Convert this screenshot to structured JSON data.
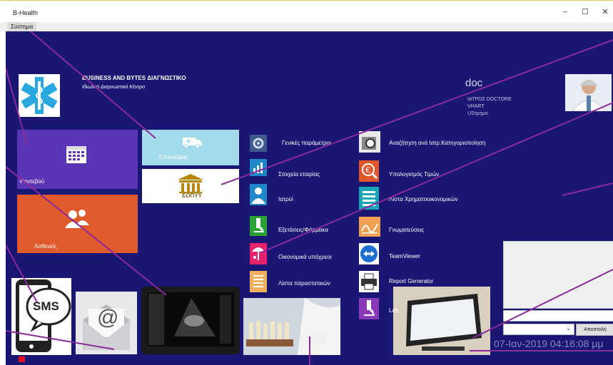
{
  "window": {
    "title": "B-Health",
    "min": "−",
    "max": "☐",
    "close": "✕"
  },
  "menu": {
    "system": "Σύστημα"
  },
  "clinic": {
    "name": "BUSINESS AND BYTES ΔΙΑΓΝΩΣΤΙΚΟ",
    "subtitle": "Ιδιωτικό Διαγνωστικό Κέντρο"
  },
  "user": {
    "short": "doc",
    "title": "ΙΑΤΡΟΣ DOCTORE",
    "name": "VHART",
    "dept": "USτμημα"
  },
  "tiles": {
    "appointments": "Ραντεβού",
    "visits": "Επισκέψεις",
    "patients": "Ασθενείς",
    "eopyy": "ΕΟΠΥΥ",
    "sms": "SMS",
    "email": "@"
  },
  "menu_col1": [
    {
      "label": "Γενικές παράμετροι",
      "icon": "gear-icon",
      "color": "#3e5a8a"
    },
    {
      "label": "Στοιχεία εταιρίας",
      "icon": "chart-icon",
      "color": "#1e88c8"
    },
    {
      "label": "Ιατροί",
      "icon": "doctor-icon",
      "color": "#1e88c8"
    },
    {
      "label": "Εξετάσεις/Φάρμακα",
      "icon": "microscope-icon",
      "color": "#2aa236"
    },
    {
      "label": "Οικονομικά υπόχρεοι",
      "icon": "umbrella-icon",
      "color": "#e8236b"
    },
    {
      "label": "Λίστα παραστατικών",
      "icon": "list-icon",
      "color": "#f0b060"
    }
  ],
  "menu_col2": [
    {
      "label": "Αναζήτηση ανά Ιατρ.Κατηγοριοποίηση",
      "icon": "search-doc-icon",
      "color": "#e8e8e8"
    },
    {
      "label": "Υπολογισμός Τιμών",
      "icon": "euro-search-icon",
      "color": "#e0552a"
    },
    {
      "label": "Λίστα Χρηματοοικονομικών",
      "icon": "finance-list-icon",
      "color": "#18a5b8"
    },
    {
      "label": "Γνωματεύσεις",
      "icon": "signature-icon",
      "color": "#f0a050"
    },
    {
      "label": "TeamViewer",
      "icon": "teamviewer-icon",
      "color": "#1e6fd0"
    },
    {
      "label": "Report Generator",
      "icon": "printer-icon",
      "color": "#ffffff"
    },
    {
      "label": "Lab",
      "icon": "lab-icon",
      "color": "#8a3ab8"
    }
  ],
  "chat": {
    "send_label": "Αποστολή",
    "combo_value": ""
  },
  "datetime": "07-Ιαν-2019 04:16:08 μμ"
}
